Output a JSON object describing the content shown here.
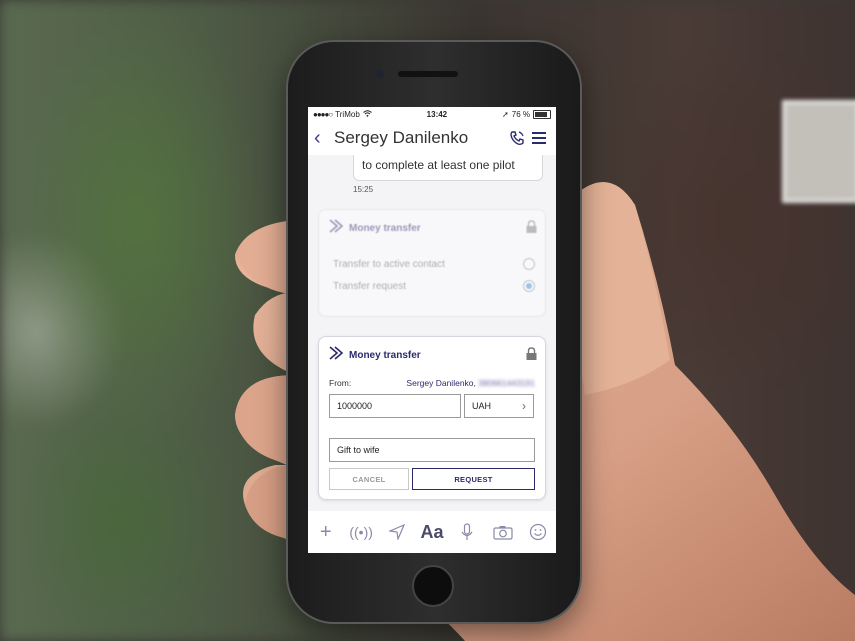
{
  "status_bar": {
    "carrier": "TriMob",
    "time": "13:42",
    "battery": "76 %"
  },
  "header": {
    "contact_name": "Sergey Danilenko"
  },
  "chat": {
    "previous_message": "to complete at least one pilot",
    "previous_time": "15:25"
  },
  "faded_card": {
    "title": "Money transfer",
    "options": [
      {
        "label": "Transfer to active contact",
        "selected": false
      },
      {
        "label": "Transfer request",
        "selected": true
      }
    ]
  },
  "transfer_card": {
    "title": "Money transfer",
    "from_label": "From:",
    "from_name": "Sergey Danilenko,",
    "from_number": "380661443191",
    "amount": "1000000",
    "currency": "UAH",
    "comment": "Gift to wife",
    "cancel_label": "CANCEL",
    "request_label": "REQUEST"
  },
  "colors": {
    "accent": "#2c2a6e",
    "radio_selected": "#2c8ae0"
  },
  "icons": [
    "back-icon",
    "phone-call-icon",
    "menu-icon",
    "transfer-logo-icon",
    "lock-icon",
    "plus-icon",
    "broadcast-icon",
    "location-icon",
    "text-format-icon",
    "microphone-icon",
    "camera-icon",
    "smiley-icon"
  ]
}
